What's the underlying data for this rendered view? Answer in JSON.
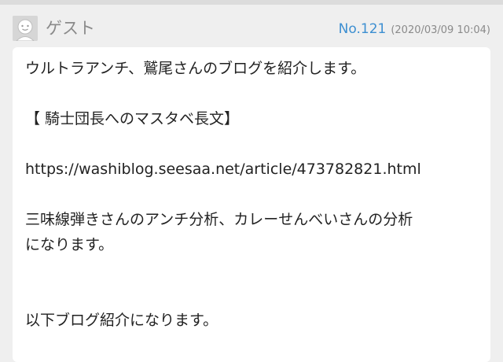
{
  "comment": {
    "author": "ゲスト",
    "number": "No.121",
    "date": "(2020/03/09 10:04)",
    "lines": [
      "ウルトラアンチ、鷲尾さんのブログを紹介します。",
      "",
      "【 騎士団長へのマスタベ長文】",
      "",
      "https://washiblog.seesaa.net/article/473782821.html",
      "",
      "三味線弾きさんのアンチ分析、カレーせんべいさんの分析",
      "になります。",
      "",
      "",
      "以下ブログ紹介になります。"
    ]
  },
  "colors": {
    "link_blue": "#3d8fd1",
    "meta_gray": "#8a8a8a",
    "background": "#efefef",
    "card": "#ffffff"
  },
  "icons": {
    "avatar": "guest-avatar-icon"
  }
}
